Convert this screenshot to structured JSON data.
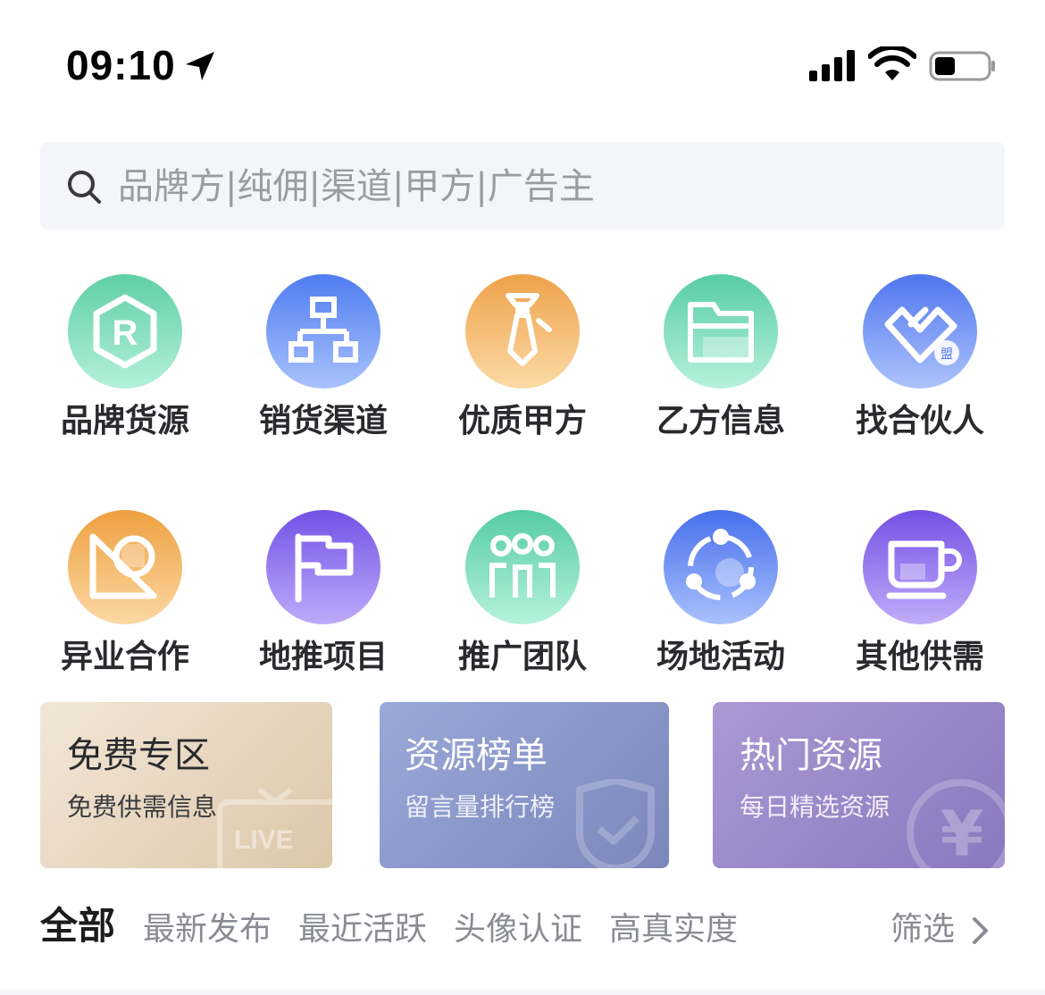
{
  "status_bar": {
    "time": "09:10"
  },
  "search": {
    "placeholder": "品牌方|纯佣|渠道|甲方|广告主"
  },
  "grid": {
    "items": [
      {
        "label": "品牌货源",
        "icon": "brand-r-icon",
        "color_top": "#6fd6b2",
        "color_bottom": "#a8ecd4"
      },
      {
        "label": "销货渠道",
        "icon": "channel-tree-icon",
        "color_top": "#5b86f2",
        "color_bottom": "#9db8fb"
      },
      {
        "label": "优质甲方",
        "icon": "tie-person-icon",
        "color_top": "#f0ac55",
        "color_bottom": "#fbd49b"
      },
      {
        "label": "乙方信息",
        "icon": "folder-icon",
        "color_top": "#62d2ac",
        "color_bottom": "#aeeed6"
      },
      {
        "label": "找合伙人",
        "icon": "partner-handshake-icon",
        "color_top": "#5a82f0",
        "color_bottom": "#a1bcfb"
      },
      {
        "label": "异业合作",
        "icon": "cross-industry-icon",
        "color_top": "#f1a64a",
        "color_bottom": "#fbd39b"
      },
      {
        "label": "地推项目",
        "icon": "flag-icon",
        "color_top": "#7b5ce8",
        "color_bottom": "#b6a1f6"
      },
      {
        "label": "推广团队",
        "icon": "team-icon",
        "color_top": "#5ecfa8",
        "color_bottom": "#acefd6"
      },
      {
        "label": "场地活动",
        "icon": "venue-activity-icon",
        "color_top": "#4f79ee",
        "color_bottom": "#9bb6fb"
      },
      {
        "label": "其他供需",
        "icon": "cup-icon",
        "color_top": "#7e5ae6",
        "color_bottom": "#b7a2f6"
      }
    ]
  },
  "cards": [
    {
      "title": "免费专区",
      "subtitle": "免费供需信息",
      "icon": "live-tv-icon",
      "bg_from": "#f0e4d2",
      "bg_to": "#dcc6a8",
      "text_color": "#2a2a2e"
    },
    {
      "title": "资源榜单",
      "subtitle": "留言量排行榜",
      "icon": "shield-check-icon",
      "bg_from": "#96a4d4",
      "bg_to": "#7c88bd",
      "text_color": "#ffffff"
    },
    {
      "title": "热门资源",
      "subtitle": "每日精选资源",
      "icon": "yen-coin-icon",
      "bg_from": "#a996d2",
      "bg_to": "#8b79c0",
      "text_color": "#ffffff"
    }
  ],
  "tabs": {
    "items": [
      "全部",
      "最新发布",
      "最近活跃",
      "头像认证",
      "高真实度"
    ],
    "active_index": 0,
    "filter_label": "筛选"
  }
}
